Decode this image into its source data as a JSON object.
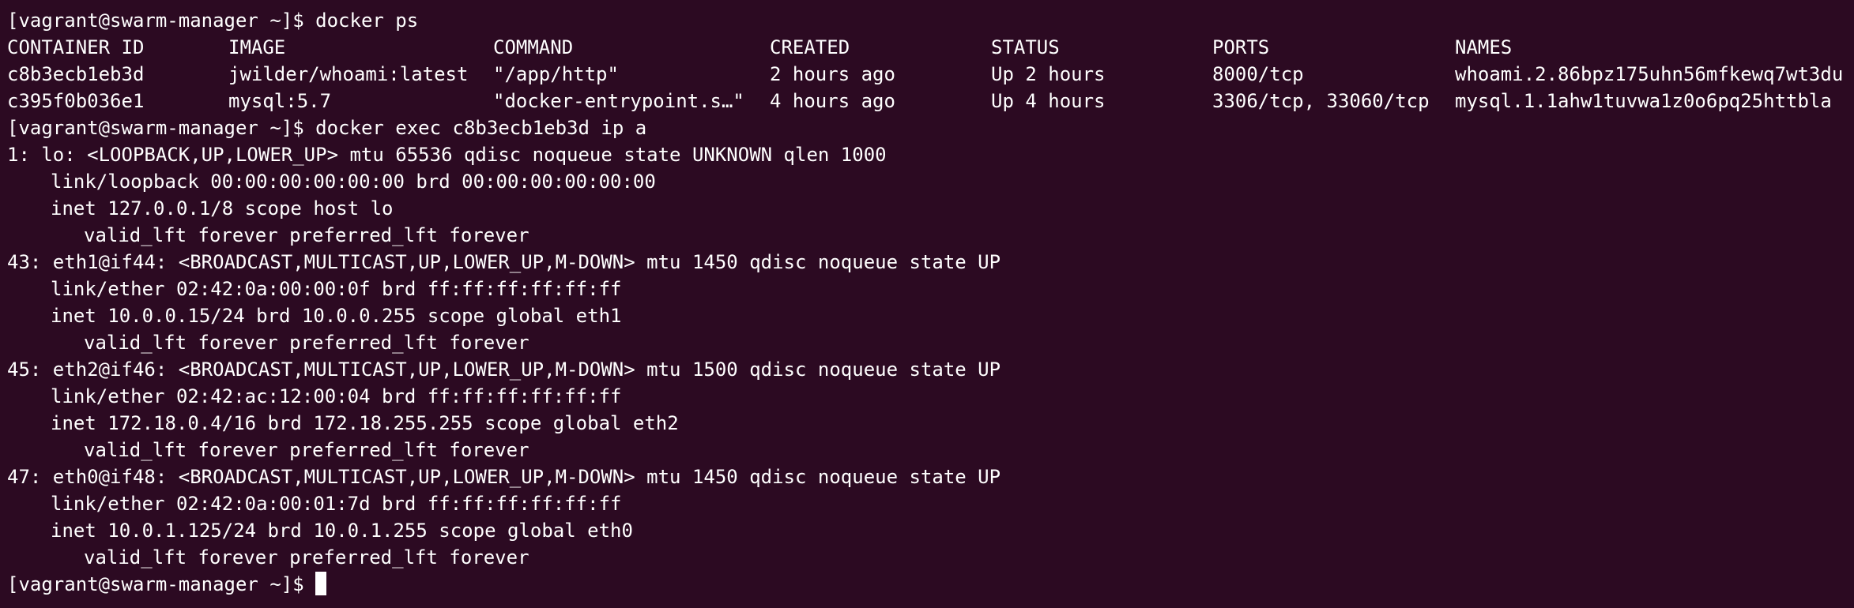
{
  "prompt": "[vagrant@swarm-manager ~]$",
  "commands": {
    "ps": "docker ps",
    "exec": "docker exec c8b3ecb1eb3d ip a"
  },
  "docker_ps": {
    "headers": [
      "CONTAINER ID",
      "IMAGE",
      "COMMAND",
      "CREATED",
      "STATUS",
      "PORTS",
      "NAMES"
    ],
    "rows": [
      [
        "c8b3ecb1eb3d",
        "jwilder/whoami:latest",
        "\"/app/http\"",
        "2 hours ago",
        "Up 2 hours",
        "8000/tcp",
        "whoami.2.86bpz175uhn56mfkewq7wt3du"
      ],
      [
        "c395f0b036e1",
        "mysql:5.7",
        "\"docker-entrypoint.s…\"",
        "4 hours ago",
        "Up 4 hours",
        "3306/tcp, 33060/tcp",
        "mysql.1.1ahw1tuvwa1z0o6pq25httbla"
      ]
    ]
  },
  "interfaces": [
    {
      "header": "1: lo: <LOOPBACK,UP,LOWER_UP> mtu 65536 qdisc noqueue state UNKNOWN qlen 1000",
      "link": "link/loopback 00:00:00:00:00:00 brd 00:00:00:00:00:00",
      "inet": "inet 127.0.0.1/8 scope host lo",
      "lft": "valid_lft forever preferred_lft forever"
    },
    {
      "header": "43: eth1@if44: <BROADCAST,MULTICAST,UP,LOWER_UP,M-DOWN> mtu 1450 qdisc noqueue state UP",
      "link": "link/ether 02:42:0a:00:00:0f brd ff:ff:ff:ff:ff:ff",
      "inet": "inet 10.0.0.15/24 brd 10.0.0.255 scope global eth1",
      "lft": "valid_lft forever preferred_lft forever"
    },
    {
      "header": "45: eth2@if46: <BROADCAST,MULTICAST,UP,LOWER_UP,M-DOWN> mtu 1500 qdisc noqueue state UP",
      "link": "link/ether 02:42:ac:12:00:04 brd ff:ff:ff:ff:ff:ff",
      "inet": "inet 172.18.0.4/16 brd 172.18.255.255 scope global eth2",
      "lft": "valid_lft forever preferred_lft forever"
    },
    {
      "header": "47: eth0@if48: <BROADCAST,MULTICAST,UP,LOWER_UP,M-DOWN> mtu 1450 qdisc noqueue state UP",
      "link": "link/ether 02:42:0a:00:01:7d brd ff:ff:ff:ff:ff:ff",
      "inet": "inet 10.0.1.125/24 brd 10.0.1.255 scope global eth0",
      "lft": "valid_lft forever preferred_lft forever"
    }
  ],
  "colors": {
    "background": "#2c0a22",
    "foreground": "#ffffff"
  }
}
